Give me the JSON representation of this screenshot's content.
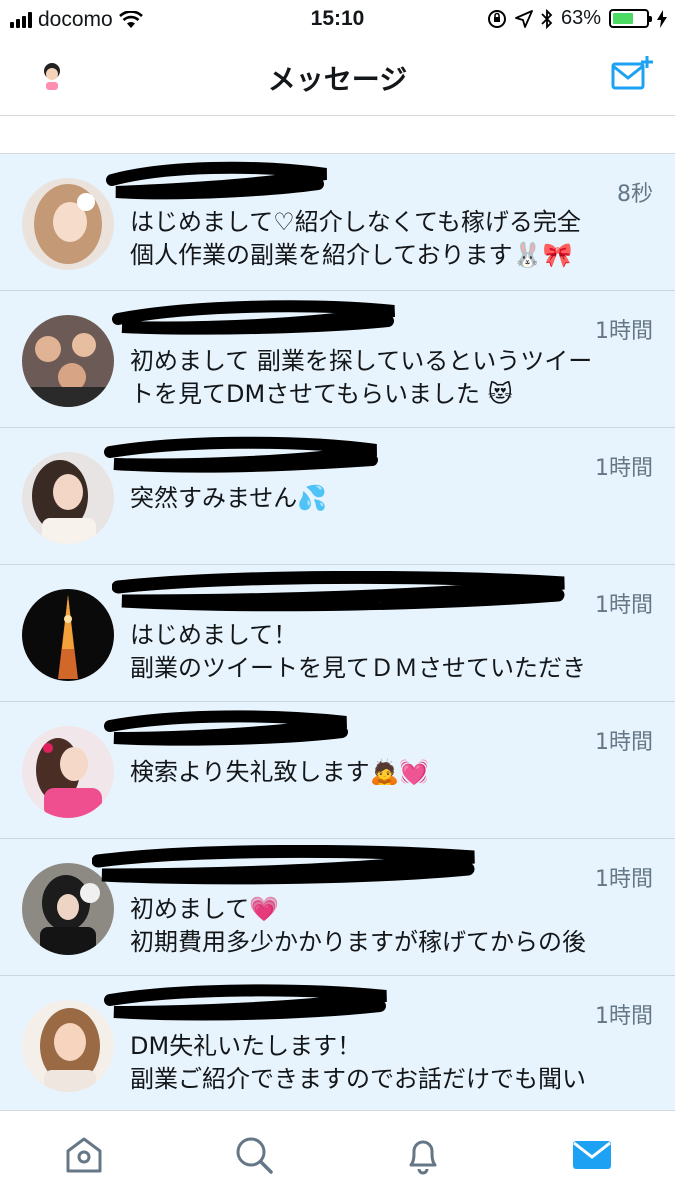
{
  "status_bar": {
    "carrier": "docomo",
    "time": "15:10",
    "battery": "63%",
    "battery_level": 0.63
  },
  "nav": {
    "title": "メッセージ",
    "compose_icon": "compose-message-icon",
    "avatar_icon": "profile-avatar-icon"
  },
  "conversations": [
    {
      "time": "8秒",
      "preview": "はじめまして♡紹介しなくても稼げる完全\n個人作業の副業を紹介しております🐰🎀"
    },
    {
      "time": "1時間",
      "preview": "初めまして 副業を探しているというツイー\nトを見てDMさせてもらいました 😻"
    },
    {
      "time": "1時間",
      "preview": "突然すみません💦"
    },
    {
      "time": "1時間",
      "preview": "はじめまして！\n副業のツイートを見てＤＭさせていただき"
    },
    {
      "time": "1時間",
      "preview": "検索より失礼致します🙇💓"
    },
    {
      "time": "1時間",
      "preview": "初めまして💗\n初期費用多少かかりますが稼げてからの後"
    },
    {
      "time": "1時間",
      "preview": "DM失礼いたします！\n副業ご紹介できますのでお話だけでも聞い"
    }
  ],
  "tab_bar": {
    "tabs": [
      "home-icon",
      "search-icon",
      "notifications-icon",
      "messages-icon"
    ],
    "active": "messages-icon",
    "accent": "#1da1f2",
    "inactive": "#657786"
  },
  "colors": {
    "unread_bg": "#e8f4fd",
    "divider": "#ccd6dd",
    "accent": "#1da1f2"
  }
}
